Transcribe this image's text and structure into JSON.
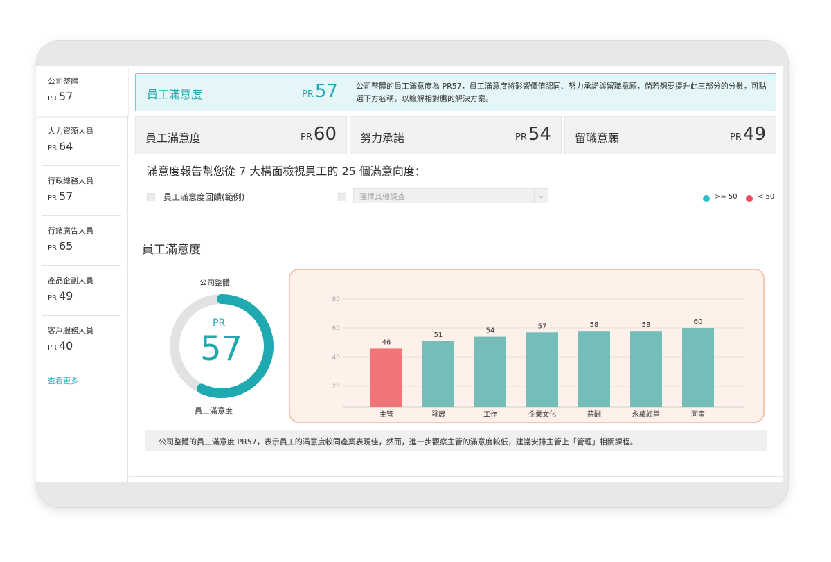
{
  "colors": {
    "accent": "#1fa9b0",
    "good": "#74bdb8",
    "bad": "#f07478",
    "legend_good": "#2bbfc6",
    "legend_bad": "#ee4a5e"
  },
  "sidebar": {
    "items": [
      {
        "name": "公司整體",
        "pr": "PR",
        "score": "57"
      },
      {
        "name": "人力資源人員",
        "pr": "PR",
        "score": "64"
      },
      {
        "name": "行政總務人員",
        "pr": "PR",
        "score": "57"
      },
      {
        "name": "行銷廣告人員",
        "pr": "PR",
        "score": "65"
      },
      {
        "name": "產品企劃人員",
        "pr": "PR",
        "score": "49"
      },
      {
        "name": "客戶服務人員",
        "pr": "PR",
        "score": "40"
      }
    ],
    "see_more": "查看更多"
  },
  "highlight": {
    "title": "員工滿意度",
    "pr": "PR",
    "score": "57",
    "desc": "公司整體的員工滿意度為 PR57，員工滿意度將影響價值認同、努力承諾與留職意願，倘若想要提升此三部分的分數，可點選下方名稱，以瞭解相對應的解決方案。"
  },
  "metrics": [
    {
      "title": "員工滿意度",
      "pr": "PR",
      "score": "60"
    },
    {
      "title": "努力承諾",
      "pr": "PR",
      "score": "54"
    },
    {
      "title": "留職意願",
      "pr": "PR",
      "score": "49"
    }
  ],
  "intro": "滿意度報告幫您從 7 大構面檢視員工的 25 個滿意向度：",
  "filters": {
    "checkbox_label": "員工滿意度回饋(範例)",
    "select_placeholder": "選擇其他調查",
    "legend_good": ">= 50",
    "legend_bad": "< 50"
  },
  "section_title": "員工滿意度",
  "donut": {
    "top_label": "公司整體",
    "bottom_label": "員工滿意度",
    "pr": "PR",
    "value": "57",
    "fraction": 0.57
  },
  "chart_data": {
    "type": "bar",
    "categories": [
      "主管",
      "發展",
      "工作",
      "企業文化",
      "薪酬",
      "永續經營",
      "同事"
    ],
    "values": [
      46,
      51,
      54,
      57,
      58,
      58,
      60
    ],
    "yticks": [
      20,
      40,
      60,
      80
    ],
    "ylim": [
      0,
      80
    ],
    "threshold": 50,
    "grid": true
  },
  "summary": "公司整體的員工滿意度 PR57，表示員工的滿意度較同產業表現佳，然而，進一步觀察主管的滿意度較低，建議安排主管上「管理」相關課程。"
}
